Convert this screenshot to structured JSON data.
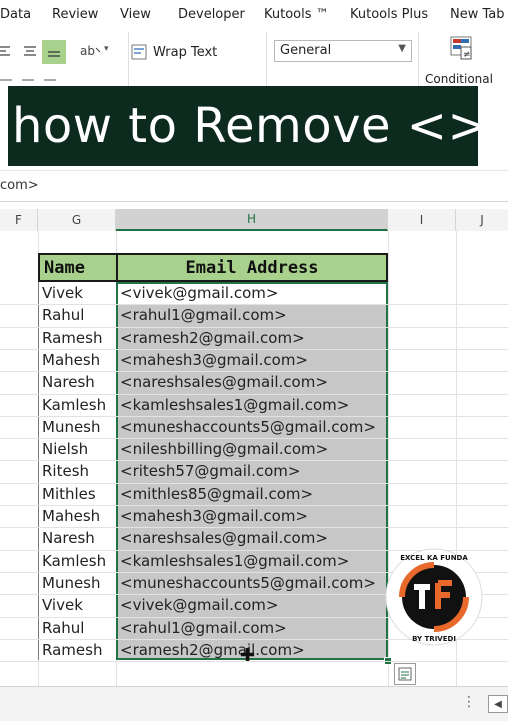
{
  "ribbon_tabs": [
    "Data",
    "Review",
    "View",
    "Developer",
    "Kutools ™",
    "Kutools Plus",
    "New Tab"
  ],
  "ribbon": {
    "wrap_text_label": "Wrap Text",
    "number_format_value": "General",
    "conditional_label": "Conditional"
  },
  "banner": {
    "text": "how to Remove <>"
  },
  "formula_bar": {
    "text": "com>"
  },
  "columns": [
    "F",
    "G",
    "H",
    "I",
    "J"
  ],
  "selected_column": "H",
  "table": {
    "headers": [
      "Name",
      "Email Address"
    ],
    "rows": [
      {
        "name": "Vivek",
        "email": "<vivek@gmail.com>"
      },
      {
        "name": "Rahul",
        "email": "<rahul1@gmail.com>"
      },
      {
        "name": "Ramesh",
        "email": "<ramesh2@gmail.com>"
      },
      {
        "name": "Mahesh",
        "email": "<mahesh3@gmail.com>"
      },
      {
        "name": "Naresh",
        "email": "<nareshsales@gmail.com>"
      },
      {
        "name": "Kamlesh",
        "email": "<kamleshsales1@gmail.com>"
      },
      {
        "name": "Munesh",
        "email": "<muneshaccounts5@gmail.com>"
      },
      {
        "name": "Nielsh",
        "email": "<nileshbilling@gmail.com>"
      },
      {
        "name": "Ritesh",
        "email": "<ritesh57@gmail.com>"
      },
      {
        "name": "Mithles",
        "email": "<mithles85@gmail.com>"
      },
      {
        "name": "Mahesh",
        "email": "<mahesh3@gmail.com>"
      },
      {
        "name": "Naresh",
        "email": "<nareshsales@gmail.com>"
      },
      {
        "name": "Kamlesh",
        "email": "<kamleshsales1@gmail.com>"
      },
      {
        "name": "Munesh",
        "email": "<muneshaccounts5@gmail.com>"
      },
      {
        "name": "Vivek",
        "email": "<vivek@gmail.com>"
      },
      {
        "name": "Rahul",
        "email": "<rahul1@gmail.com>"
      },
      {
        "name": "Ramesh",
        "email": "<ramesh2@gmail.com>"
      }
    ]
  },
  "logo": {
    "top_text": "EXCEL KA FUNDA",
    "bottom_text": "BY TRIVEDI",
    "mark_text": "क F"
  },
  "colors": {
    "header_fill": "#a9d18e",
    "selection": "#c7c7c7",
    "excel_green": "#217346",
    "banner_bg": "#0c2a1e"
  }
}
